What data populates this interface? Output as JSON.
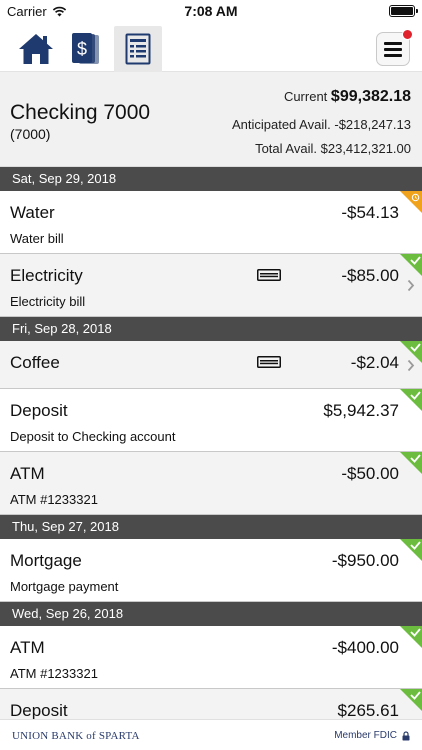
{
  "status_bar": {
    "carrier": "Carrier",
    "time": "7:08 AM",
    "icons": [
      "wifi-icon",
      "battery-icon"
    ]
  },
  "tabs": [
    {
      "icon": "home-icon",
      "active": false
    },
    {
      "icon": "money-icon",
      "active": false
    },
    {
      "icon": "register-icon",
      "active": true
    }
  ],
  "menu": {
    "icon": "hamburger-menu-icon",
    "has_notification": true
  },
  "account": {
    "name": "Checking 7000",
    "number": "(7000)",
    "current_label": "Current",
    "current_value": "$99,382.18",
    "anticipated_label": "Anticipated Avail.",
    "anticipated_value": "-$218,247.13",
    "total_label": "Total Avail.",
    "total_value": "$23,412,321.00"
  },
  "groups": [
    {
      "date": "Sat, Sep 29, 2018",
      "transactions": [
        {
          "name": "Water",
          "amount": "-$54.13",
          "description": "Water bill",
          "status": "pending"
        },
        {
          "name": "Electricity",
          "amount": "-$85.00",
          "description": "Electricity bill",
          "status": "cleared",
          "has_card": true,
          "has_chevron": true
        }
      ]
    },
    {
      "date": "Fri, Sep 28, 2018",
      "transactions": [
        {
          "name": "Coffee",
          "amount": "-$2.04",
          "description": "",
          "status": "cleared",
          "has_card": true,
          "has_chevron": true
        },
        {
          "name": "Deposit",
          "amount": "$5,942.37",
          "description": "Deposit to Checking account",
          "status": "cleared"
        },
        {
          "name": "ATM",
          "amount": "-$50.00",
          "description": "ATM #1233321",
          "status": "cleared"
        }
      ]
    },
    {
      "date": "Thu, Sep 27, 2018",
      "transactions": [
        {
          "name": "Mortgage",
          "amount": "-$950.00",
          "description": "Mortgage payment",
          "status": "cleared"
        }
      ]
    },
    {
      "date": "Wed, Sep 26, 2018",
      "transactions": [
        {
          "name": "ATM",
          "amount": "-$400.00",
          "description": "ATM #1233321",
          "status": "cleared"
        },
        {
          "name": "Deposit",
          "amount": "$265.61",
          "description": "",
          "status": "cleared"
        }
      ]
    }
  ],
  "footer": {
    "bank": "UNION BANK of SPARTA",
    "fdic": "Member FDIC",
    "fdic_icon": "lock-icon"
  },
  "colors": {
    "brand_navy": "#1f3a6e",
    "date_header": "#4b4b4b",
    "cleared_green": "#6cbd3f",
    "pending_orange": "#f0a21c",
    "notification_red": "#e0222c"
  }
}
